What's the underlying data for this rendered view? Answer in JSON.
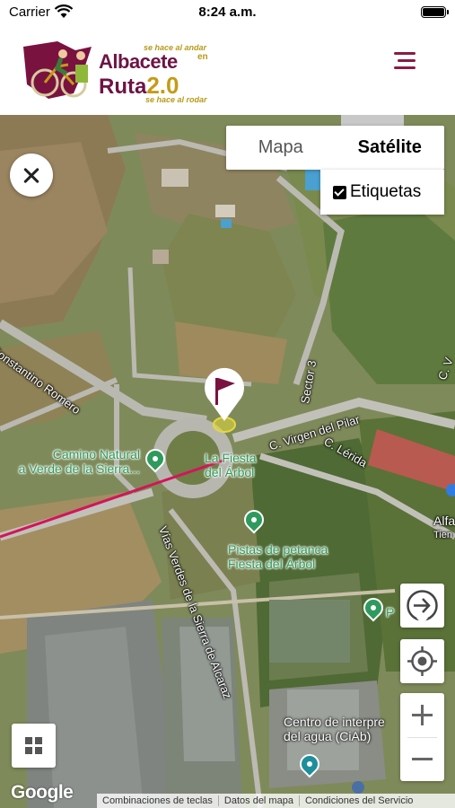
{
  "status_bar": {
    "carrier": "Carrier",
    "time": "8:24 a.m."
  },
  "header": {
    "logo": {
      "tagline_top": "se hace al andar",
      "line1": "Albacete",
      "line1_suffix": "en",
      "line2": "Ruta",
      "version": "2.0",
      "tagline_bottom": "se hace al rodar"
    },
    "menu_icon": "hamburger-icon",
    "colors": {
      "brand": "#6d1444",
      "accent": "#c59b16"
    }
  },
  "map": {
    "map_type": {
      "options": [
        "Mapa",
        "Satélite"
      ],
      "selected": "Satélite"
    },
    "labels_toggle": {
      "label": "Etiquetas",
      "checked": true
    },
    "street_labels": [
      "Constantino Romero",
      "Sector 3",
      "C. Virgen del Pilar",
      "C. Lérida",
      "Vías Verdes de la Sierra de Alcaraz",
      "C. V",
      "Alfa",
      "Tien"
    ],
    "pois": [
      {
        "name_line1": "Camino Natural",
        "name_line2": "a Verde de la Sierra..."
      },
      {
        "name_line1": "La Fiesta",
        "name_line2": "del Árbol"
      },
      {
        "name_line1": "Pistas de petanca",
        "name_line2": "Fiesta del Árbol"
      },
      {
        "name_line1": "Centro de interpre",
        "name_line2": "del agua (CiAb)"
      },
      {
        "name_line1": "P",
        "name_line2": ""
      }
    ],
    "route_color": "#d4145a",
    "google": "Google",
    "attribution": [
      "Combinaciones de teclas",
      "Datos del mapa",
      "Condiciones del Servicio"
    ]
  }
}
